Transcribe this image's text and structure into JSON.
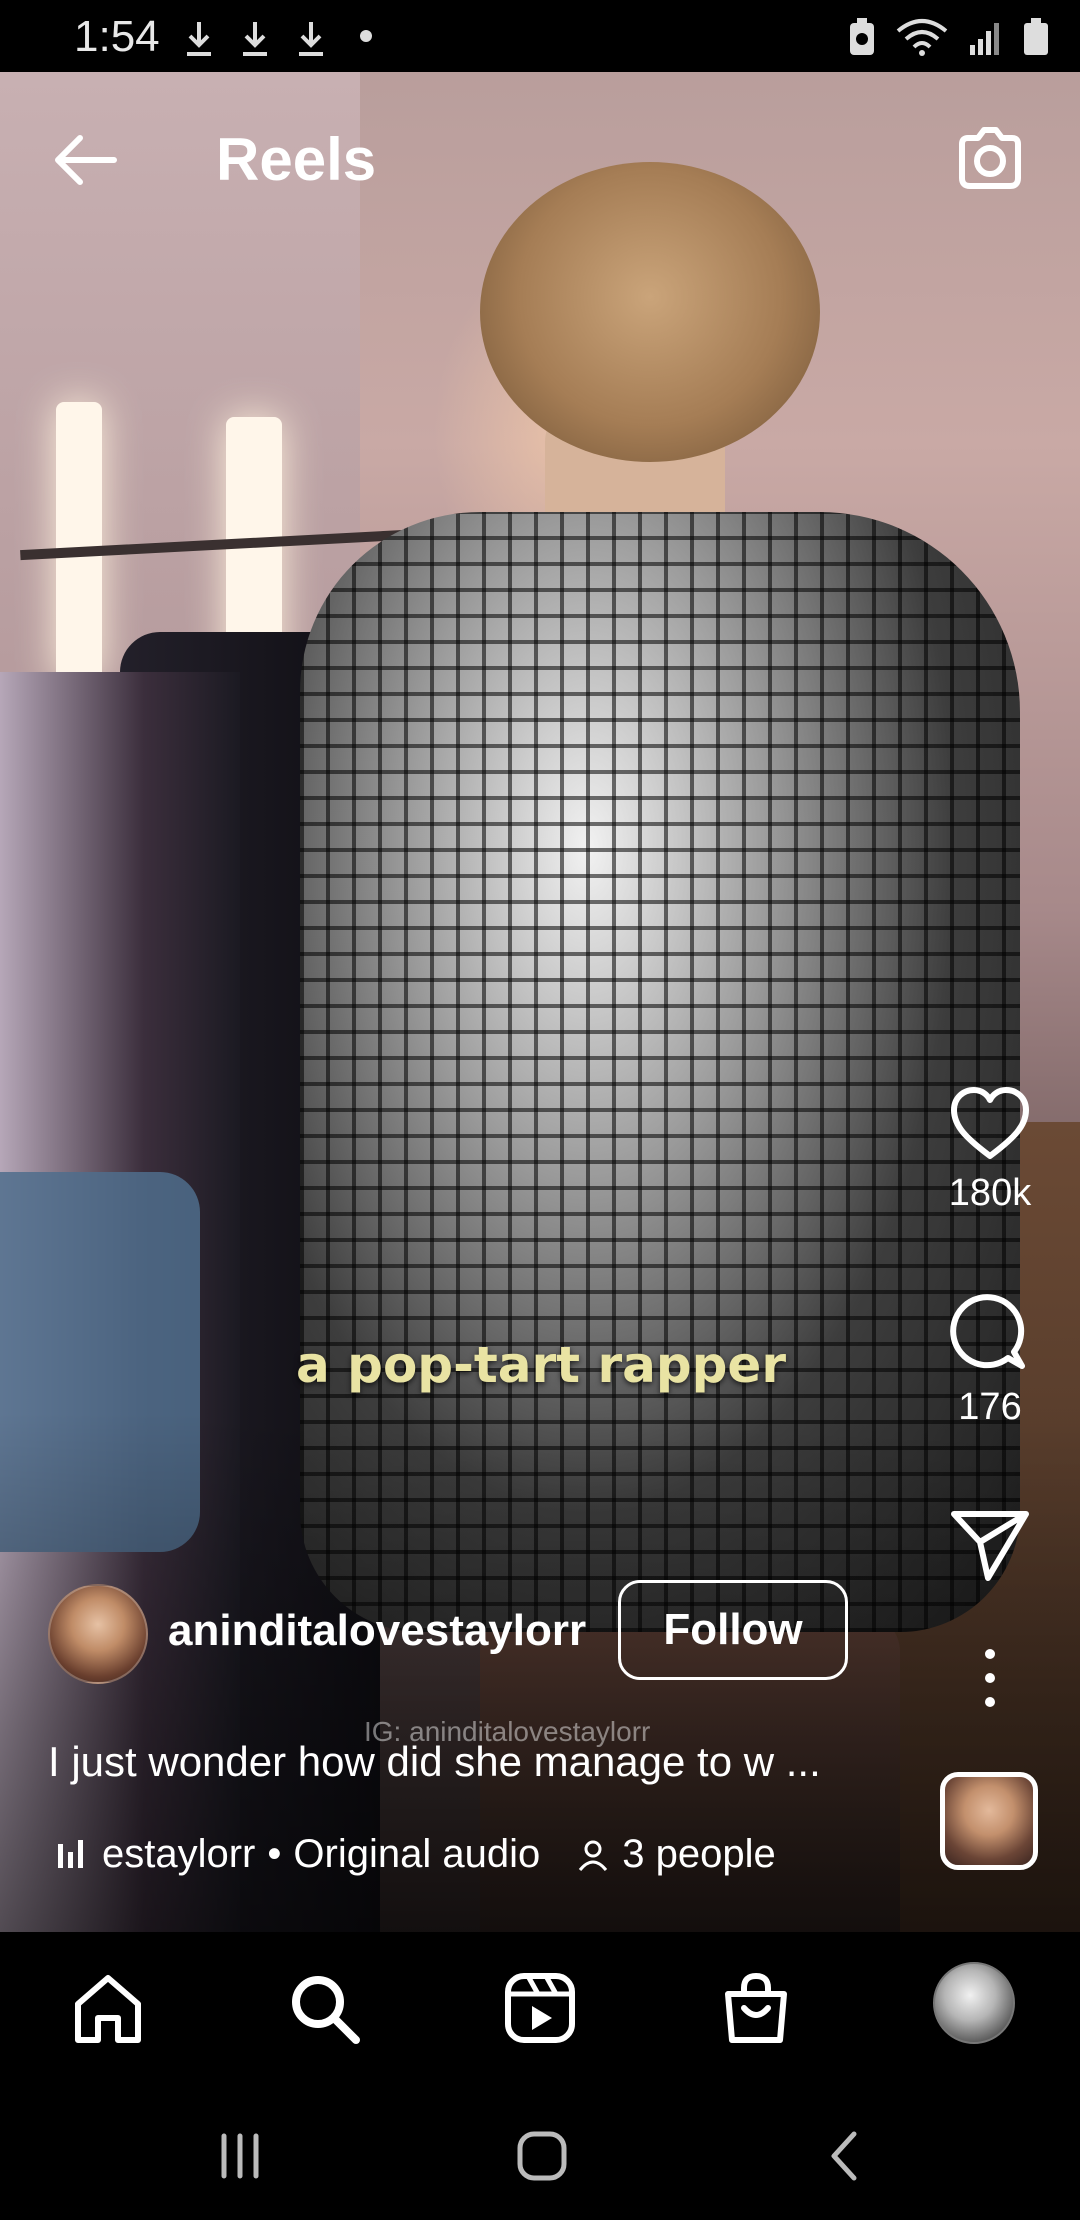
{
  "status_bar": {
    "time": "1:54"
  },
  "header": {
    "title": "Reels"
  },
  "reel": {
    "overlay_caption": "a pop-tart rapper",
    "watermark": "IG: aninditalovestaylorr"
  },
  "actions": {
    "like_count": "180k",
    "comment_count": "176"
  },
  "post": {
    "username": "aninditalovestaylorr",
    "follow_label": "Follow",
    "caption": "I just wonder how did she manage to w ...",
    "audio_author": "estaylorr",
    "audio_separator": "•",
    "audio_name": "Original audio",
    "people": "3 people"
  },
  "colors": {
    "overlay_caption": "#e9e3a3",
    "background": "#000000",
    "text": "#ffffff"
  },
  "icons": {
    "header": [
      "back-arrow-icon",
      "camera-icon"
    ],
    "actions": [
      "heart-icon",
      "comment-icon",
      "send-icon",
      "more-vertical-icon"
    ],
    "bottom_nav": [
      "home-icon",
      "search-icon",
      "reels-icon",
      "shop-icon",
      "profile-avatar"
    ],
    "system_nav": [
      "recent-apps-icon",
      "home-button-icon",
      "back-button-icon"
    ]
  }
}
